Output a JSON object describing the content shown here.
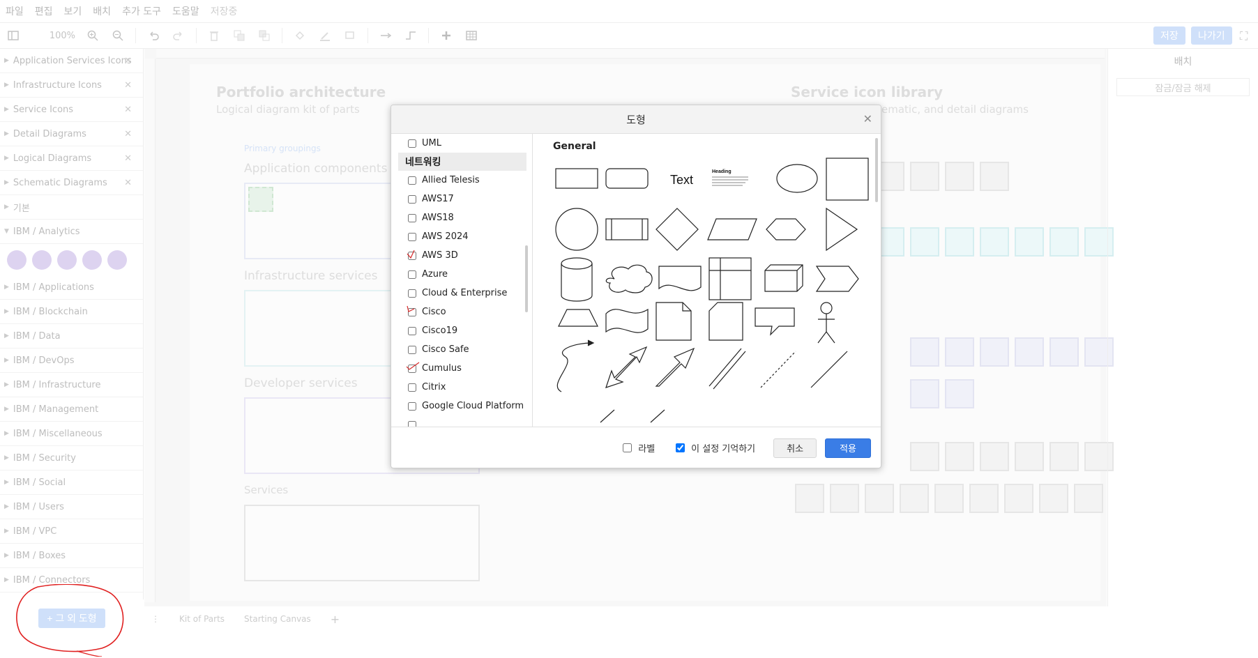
{
  "menu": [
    "파일",
    "편집",
    "보기",
    "배치",
    "추가 도구",
    "도움말",
    "저장중"
  ],
  "toolbar": {
    "zoom": "100%",
    "save_label": "저장",
    "exit_label": "나가기"
  },
  "sidebar": {
    "libraries": [
      "Application Services Icons",
      "Infrastructure Icons",
      "Service Icons",
      "Detail Diagrams",
      "Logical Diagrams",
      "Schematic Diagrams",
      "기본",
      "IBM / Analytics",
      "IBM / Applications",
      "IBM / Blockchain",
      "IBM / Data",
      "IBM / DevOps",
      "IBM / Infrastructure",
      "IBM / Management",
      "IBM / Miscellaneous",
      "IBM / Security",
      "IBM / Social",
      "IBM / Users",
      "IBM / VPC",
      "IBM / Boxes",
      "IBM / Connectors"
    ],
    "more_shapes": "+ 그 외 도형"
  },
  "canvas": {
    "left_title": "Portfolio architecture",
    "left_subtitle": "Logical diagram kit of parts",
    "primary_groupings": "Primary groupings",
    "app_components": "Application components",
    "infra_services": "Infrastructure services",
    "developer_services": "Developer services",
    "services": "Services",
    "right_title": "Service icon library",
    "right_subtitle_tail": "ematic, and detail diagrams"
  },
  "right_panel": {
    "title": "배치",
    "lock": "잠금/잠금 해제"
  },
  "bottom_tabs": [
    "Kit of Parts",
    "Starting Canvas"
  ],
  "dialog": {
    "title": "도형",
    "libraries": [
      {
        "label": "UML",
        "checked": false
      },
      {
        "section": "네트워킹"
      },
      {
        "label": "Allied Telesis",
        "checked": false
      },
      {
        "label": "AWS17",
        "checked": false
      },
      {
        "label": "AWS18",
        "checked": false
      },
      {
        "label": "AWS 2024",
        "checked": false
      },
      {
        "label": "AWS 3D",
        "checked": false
      },
      {
        "label": "Azure",
        "checked": false
      },
      {
        "label": "Cloud & Enterprise",
        "checked": false
      },
      {
        "label": "Cisco",
        "checked": false
      },
      {
        "label": "Cisco19",
        "checked": false
      },
      {
        "label": "Cisco Safe",
        "checked": false
      },
      {
        "label": "Cumulus",
        "checked": false
      },
      {
        "label": "Citrix",
        "checked": false
      },
      {
        "label": "Google Cloud Platform",
        "checked": false
      }
    ],
    "preview_title": "General",
    "preview_text": "Text",
    "preview_heading": "Heading",
    "footer": {
      "label_checkbox": "라벨",
      "remember_checkbox": "이 설정 기억하기",
      "cancel": "취소",
      "apply": "적용"
    }
  }
}
